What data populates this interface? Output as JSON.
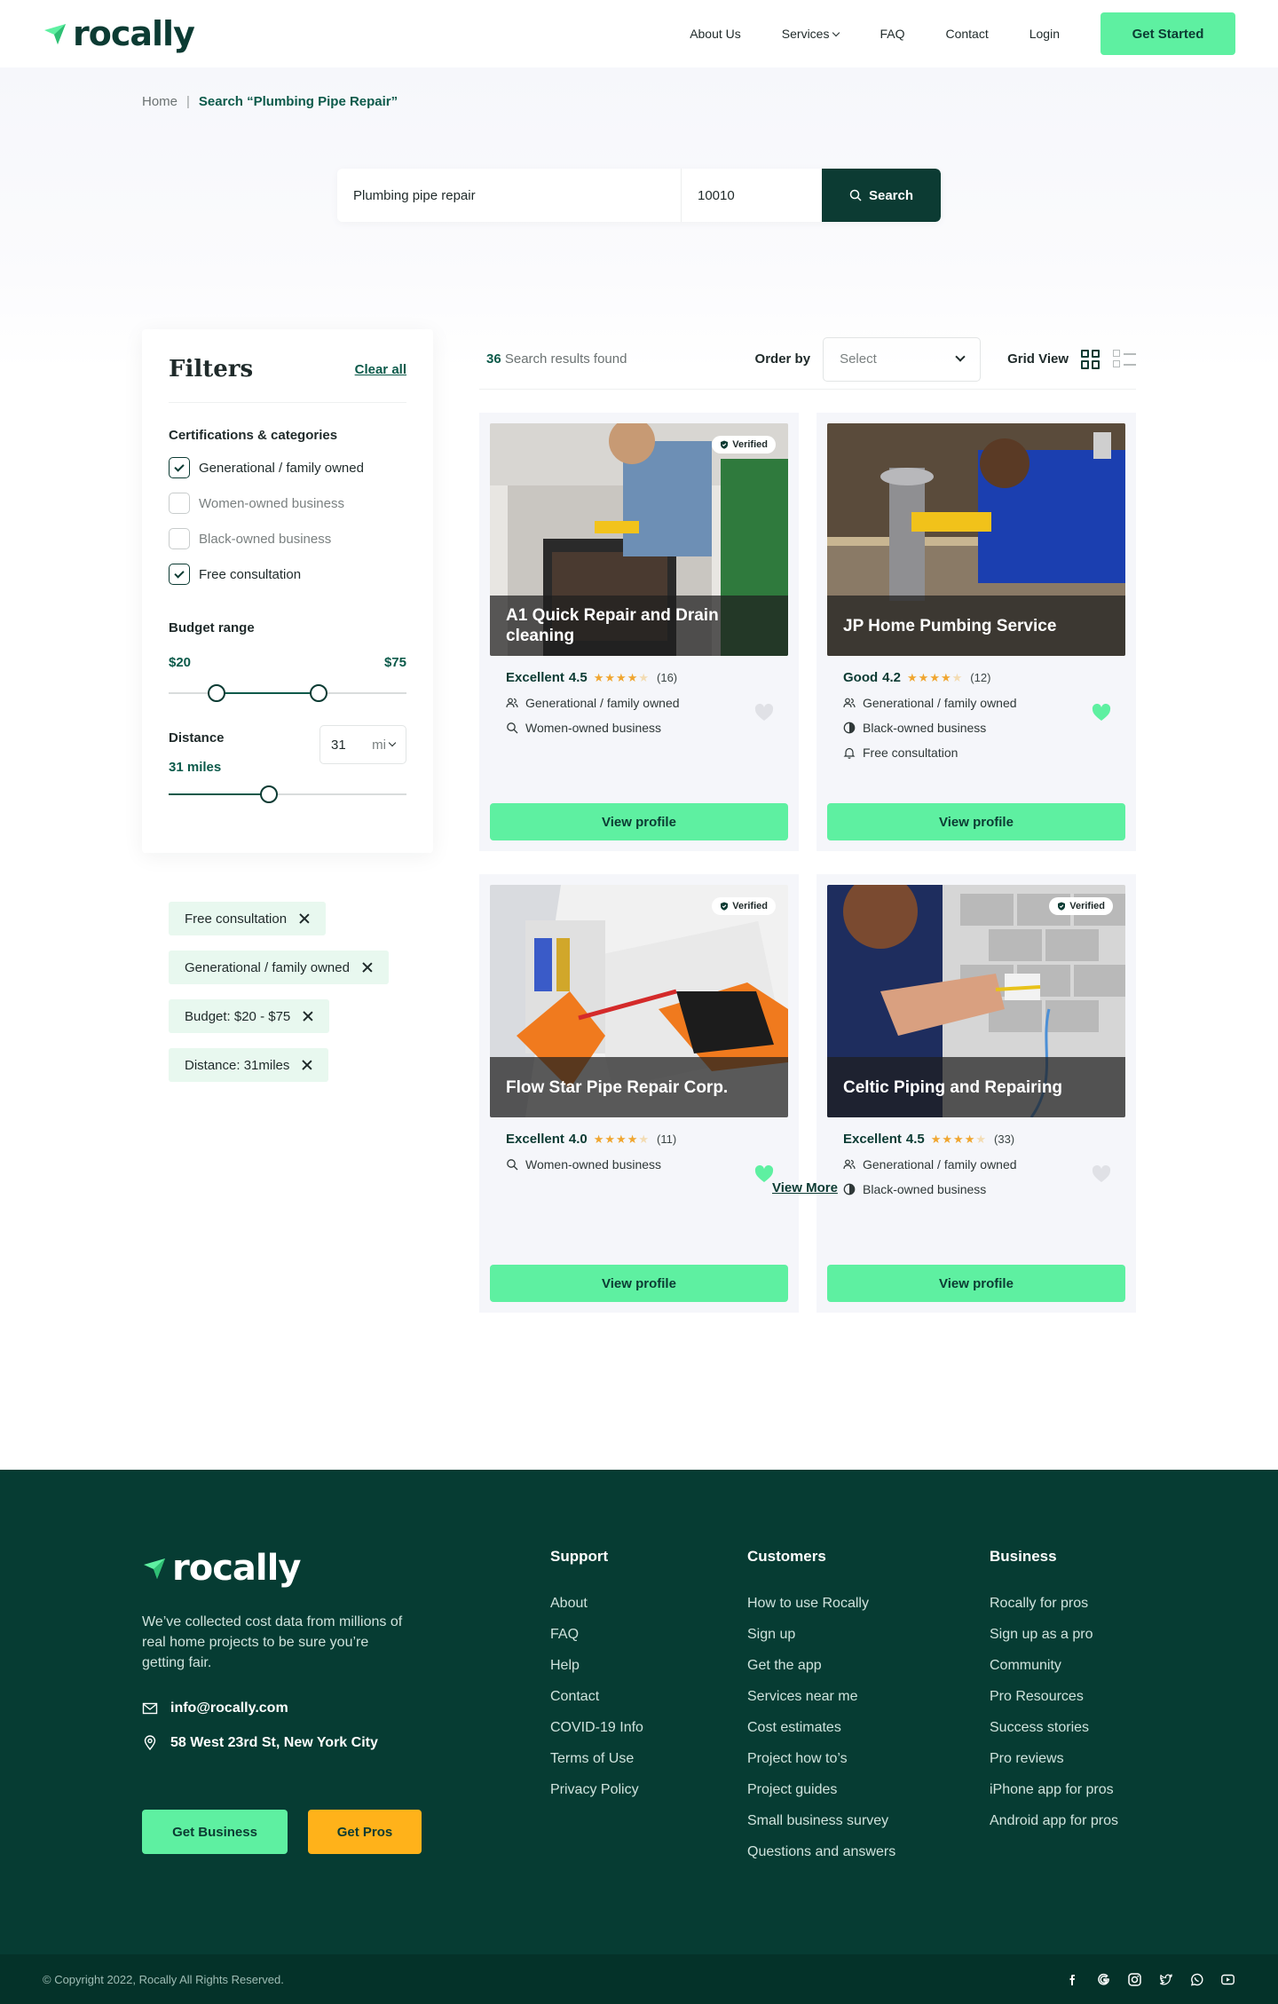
{
  "brand": {
    "name": "rocally",
    "accent": "#5ef0a1",
    "primary": "#0c3b33"
  },
  "nav": {
    "links": [
      "About Us",
      "Services",
      "FAQ",
      "Contact",
      "Login"
    ],
    "cta": "Get Started"
  },
  "breadcrumb": {
    "home": "Home",
    "current": "Search “Plumbing Pipe Repair”"
  },
  "search": {
    "query": "Plumbing pipe repair",
    "zip": "10010",
    "button": "Search"
  },
  "filters": {
    "title": "Filters",
    "clear": "Clear all",
    "categories_title": "Certifications & categories",
    "categories": [
      {
        "label": "Generational / family owned",
        "checked": true
      },
      {
        "label": "Women-owned business",
        "checked": false
      },
      {
        "label": "Black-owned business",
        "checked": false
      },
      {
        "label": "Free consultation",
        "checked": true
      }
    ],
    "budget_title": "Budget range",
    "budget_min": "$20",
    "budget_max": "$75",
    "distance_title": "Distance",
    "distance_label": "31 miles",
    "distance_value": "31",
    "distance_unit": "mi",
    "active": [
      "Free consultation",
      "Generational / family owned",
      "Budget: $20 - $75",
      "Distance: 31miles"
    ]
  },
  "results": {
    "count": "36",
    "count_label": "Search results found",
    "order_label": "Order by",
    "order_placeholder": "Select",
    "view_label": "Grid View",
    "verified_label": "Verified",
    "view_button": "View profile",
    "view_more": "View More",
    "cards": [
      {
        "name": "A1 Quick Repair and Drain cleaning",
        "rating_word": "Excellent",
        "rating": "4.5",
        "reviews": "(16)",
        "verified": true,
        "favorite": false,
        "features": [
          {
            "icon": "people-icon",
            "label": "Generational / family owned"
          },
          {
            "icon": "search-icon",
            "label": "Women-owned business"
          }
        ]
      },
      {
        "name": "JP Home Pumbing Service",
        "rating_word": "Good",
        "rating": "4.2",
        "reviews": "(12)",
        "verified": false,
        "favorite": true,
        "features": [
          {
            "icon": "people-icon",
            "label": "Generational / family owned"
          },
          {
            "icon": "half-circle-icon",
            "label": "Black-owned business"
          },
          {
            "icon": "bell-icon",
            "label": "Free consultation"
          }
        ]
      },
      {
        "name": "Flow Star Pipe Repair Corp.",
        "rating_word": "Excellent",
        "rating": "4.0",
        "reviews": "(11)",
        "verified": true,
        "favorite": true,
        "features": [
          {
            "icon": "search-icon",
            "label": "Women-owned business"
          }
        ]
      },
      {
        "name": "Celtic Piping and Repairing",
        "rating_word": "Excellent",
        "rating": "4.5",
        "reviews": "(33)",
        "verified": true,
        "favorite": false,
        "features": [
          {
            "icon": "people-icon",
            "label": "Generational / family owned"
          },
          {
            "icon": "half-circle-icon",
            "label": "Black-owned business"
          }
        ]
      }
    ]
  },
  "footer": {
    "description": "We’ve collected cost data from millions of real home projects to be sure you’re getting fair.",
    "email": "info@rocally.com",
    "address": "58 West 23rd St, New York City",
    "btn_business": "Get Business",
    "btn_pros": "Get Pros",
    "columns": [
      {
        "title": "Support",
        "items": [
          "About",
          "FAQ",
          "Help",
          "Contact",
          "COVID-19 Info",
          "Terms of Use",
          "Privacy Policy"
        ]
      },
      {
        "title": "Customers",
        "items": [
          "How to use Rocally",
          "Sign up",
          "Get the app",
          "Services near me",
          "Cost estimates",
          "Project how to’s",
          "Project guides",
          "Small business survey",
          "Questions and answers"
        ]
      },
      {
        "title": "Business",
        "items": [
          "Rocally for pros",
          "Sign up as a pro",
          "Community",
          "Pro Resources",
          "Success stories",
          "Pro reviews",
          "iPhone app for pros",
          "Android app for pros"
        ]
      }
    ],
    "copyright": "© Copyright 2022, Rocally All Rights Reserved.",
    "socials": [
      "facebook-icon",
      "google-icon",
      "instagram-icon",
      "twitter-icon",
      "whatsapp-icon",
      "youtube-icon"
    ]
  }
}
